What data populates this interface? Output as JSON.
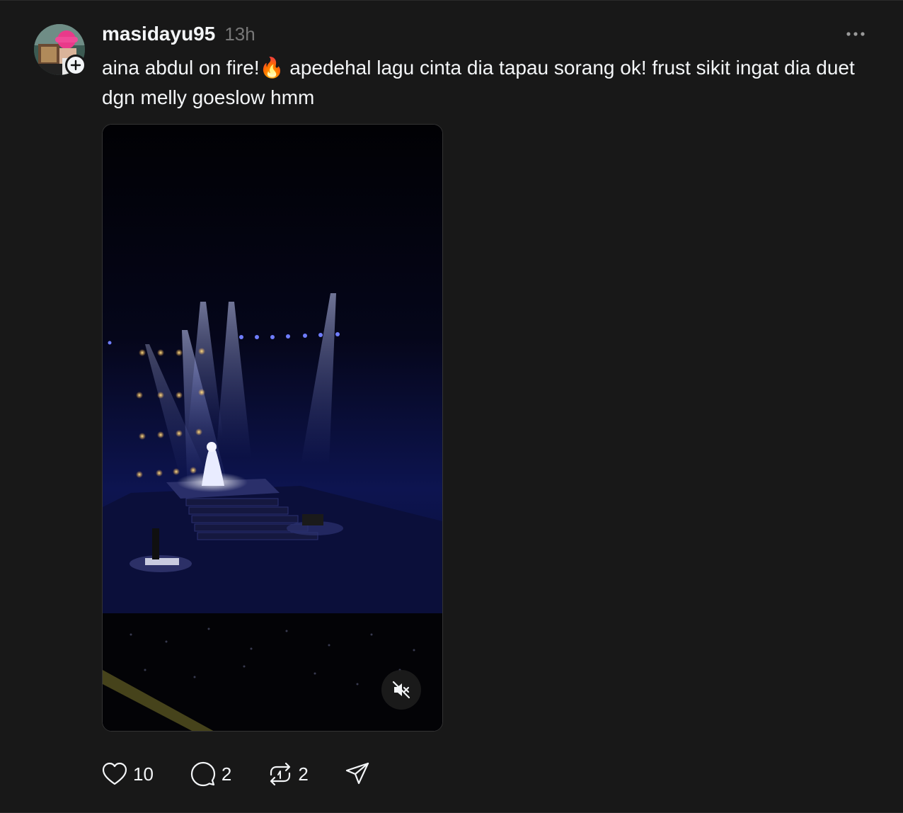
{
  "post": {
    "author": {
      "username": "masidayu95",
      "avatar_icon": "avatar-image",
      "follow_icon": "plus-icon"
    },
    "time": "13h",
    "more_icon": "ellipsis-icon",
    "caption": "aina abdul on fire!🔥 apedehal lagu cinta dia tapau sorang ok! frust sikit ingat dia duet dgn melly goeslow hmm",
    "media": {
      "type": "video",
      "description_icon": "concert-stage-video",
      "mute_icon": "speaker-muted-icon"
    },
    "actions": {
      "likes": "10",
      "comments": "2",
      "reposts": "2",
      "like_icon": "heart-icon",
      "comment_icon": "comment-bubble-icon",
      "repost_icon": "repost-icon",
      "share_icon": "send-icon"
    }
  },
  "colors": {
    "background": "#181818",
    "text": "#f3f5f7",
    "muted": "#777777"
  }
}
